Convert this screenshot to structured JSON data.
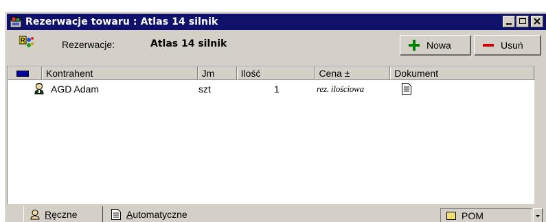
{
  "window": {
    "title": "Rezerwacje towaru : Atlas 14 silnik",
    "title_color": "#10116b"
  },
  "toolbar": {
    "label": "Rezerwacje:",
    "value": "Atlas 14 silnik",
    "new_label": "Nowa",
    "delete_label": "Usuń",
    "new_icon": "plus-icon",
    "delete_icon": "minus-icon",
    "new_color": "#008000",
    "delete_color": "#cc0000"
  },
  "grid": {
    "columns": [
      "Kontrahent",
      "Jm",
      "Ilość",
      "Cena ±",
      "Dokument"
    ],
    "rows": [
      {
        "icon": "person-icon",
        "kontrahent": "AGD Adam",
        "jm": "szt",
        "ilosc": "1",
        "cena": "rez. ilościowa",
        "dokument_icon": "document-icon"
      }
    ]
  },
  "tabs": {
    "manual_pre": "R",
    "manual_rest": "ęczne",
    "auto_pre": "A",
    "auto_rest": "utomatyczne"
  },
  "combo": {
    "value": "POM"
  }
}
